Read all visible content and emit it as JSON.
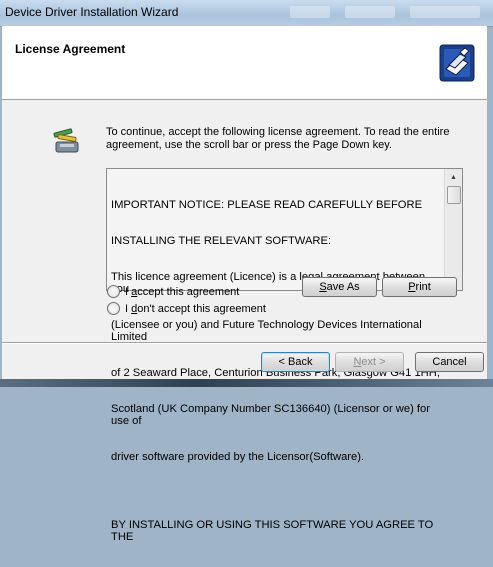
{
  "window": {
    "title": "Device Driver Installation Wizard"
  },
  "header": {
    "title": "License Agreement",
    "icon": "hardware-install-icon"
  },
  "intro": {
    "icon": "wizard-icon",
    "text": "To continue, accept the following license agreement. To read the entire agreement, use the scroll bar or press the Page Down key."
  },
  "license": {
    "lines": [
      "IMPORTANT NOTICE: PLEASE READ CAREFULLY BEFORE",
      "INSTALLING THE RELEVANT SOFTWARE:",
      "This licence agreement (Licence) is a legal agreement between you",
      "(Licensee or you) and Future Technology Devices International Limited",
      "of 2 Seaward Place, Centurion Business Park, Glasgow G41 1HH,",
      "Scotland (UK Company Number SC136640) (Licensor or we) for use of",
      "driver software provided by the Licensor(Software).",
      "",
      "BY INSTALLING OR USING THIS SOFTWARE YOU AGREE TO THE"
    ]
  },
  "options": {
    "accept_prefix": "I ",
    "accept_mnemonic": "a",
    "accept_rest": "ccept this agreement",
    "decline_prefix": "I ",
    "decline_mnemonic": "d",
    "decline_rest": "on't accept this agreement"
  },
  "buttons": {
    "save_as_mnemonic": "S",
    "save_as_rest": "ave As",
    "print_mnemonic": "P",
    "print_rest": "rint",
    "back": "< Back",
    "next_mnemonic": "N",
    "next_rest": "ext >",
    "cancel": "Cancel"
  }
}
